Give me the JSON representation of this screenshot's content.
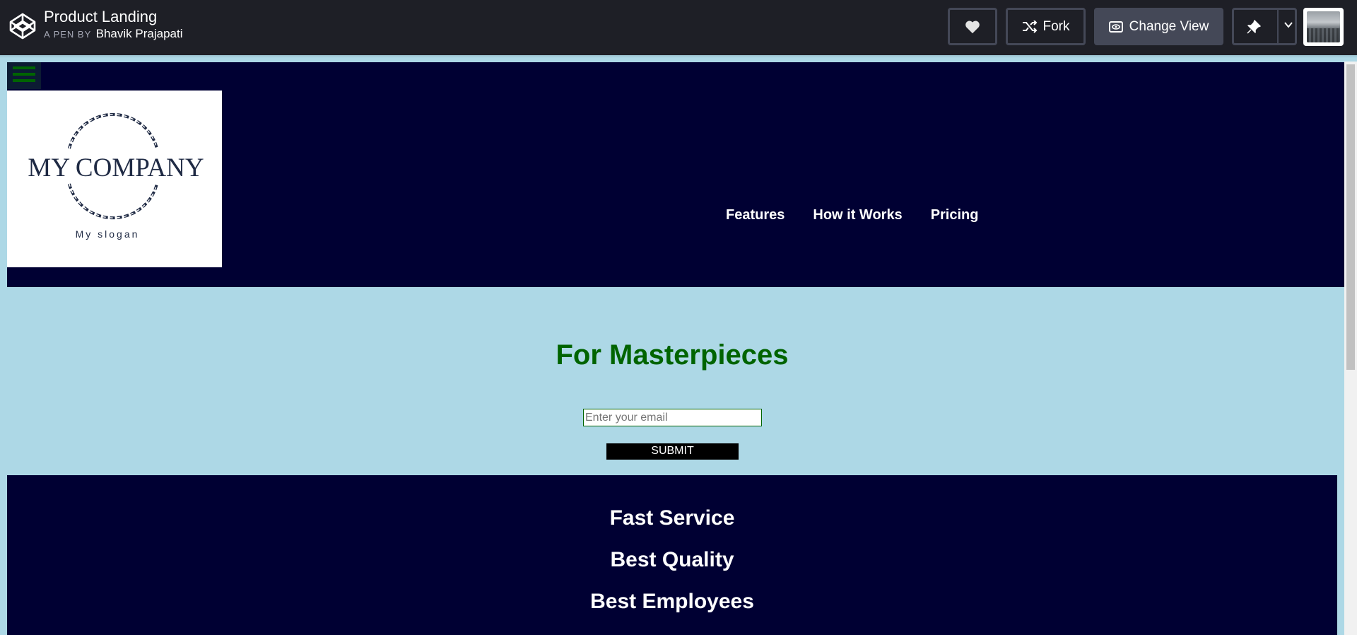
{
  "codepen": {
    "title": "Product Landing",
    "by_label": "A PEN BY",
    "author": "Bhavik Prajapati",
    "fork_label": "Fork",
    "change_view_label": "Change View"
  },
  "logo": {
    "company": "MY COMPANY",
    "slogan": "My slogan"
  },
  "nav": {
    "items": [
      "Features",
      "How it Works",
      "Pricing"
    ]
  },
  "hero": {
    "title": "For Masterpieces",
    "email_placeholder": "Enter your email",
    "submit_label": "SUBMIT"
  },
  "features": {
    "items": [
      "Fast Service",
      "Best Quality",
      "Best Employees"
    ]
  },
  "colors": {
    "header_bg": "#000033",
    "page_bg": "#add8e6",
    "accent_green": "#006400",
    "codepen_bar": "#1e1f26"
  }
}
